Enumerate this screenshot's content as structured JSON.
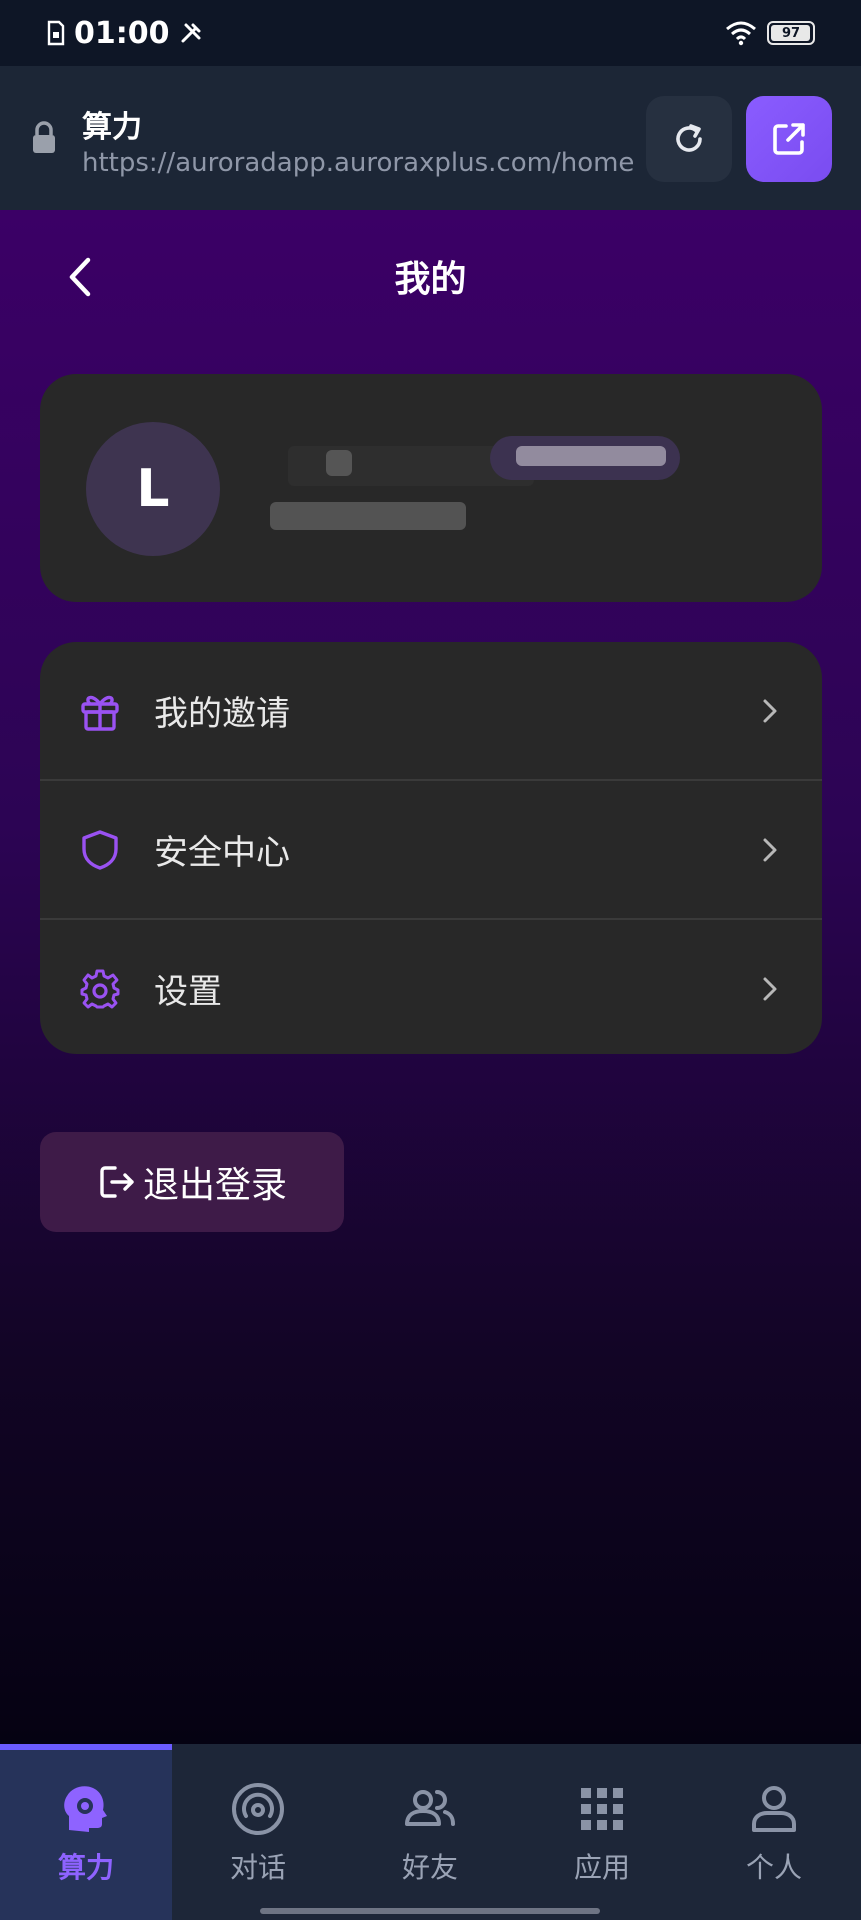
{
  "status_bar": {
    "time": "01:00",
    "battery": "97",
    "battery_level": 0.97
  },
  "browser": {
    "title": "算力",
    "url": "https://auroradapp.auroraxplus.com/home"
  },
  "page": {
    "title": "我的"
  },
  "profile": {
    "avatar_initial": "L"
  },
  "menu": {
    "items": [
      {
        "label": "我的邀请",
        "icon": "gift-icon"
      },
      {
        "label": "安全中心",
        "icon": "shield-icon"
      },
      {
        "label": "设置",
        "icon": "gear-icon"
      }
    ]
  },
  "logout": {
    "label": "退出登录"
  },
  "bottom_nav": {
    "items": [
      {
        "label": "算力",
        "icon": "ai-head-icon",
        "active": true
      },
      {
        "label": "对话",
        "icon": "broadcast-icon",
        "active": false
      },
      {
        "label": "好友",
        "icon": "friends-icon",
        "active": false
      },
      {
        "label": "应用",
        "icon": "apps-grid-icon",
        "active": false
      },
      {
        "label": "个人",
        "icon": "person-icon",
        "active": false
      }
    ]
  },
  "colors": {
    "accent": "#8e63ff",
    "card": "#282828",
    "background_top": "#3b0066"
  }
}
